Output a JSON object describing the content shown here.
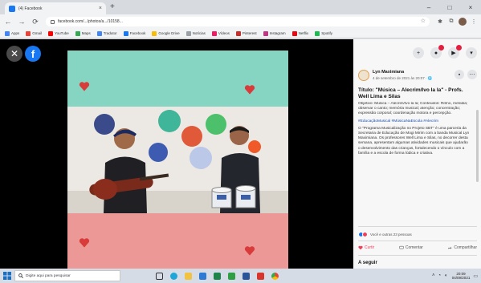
{
  "browser": {
    "tab_title": "(4) Facebook",
    "tab_close": "×",
    "new_tab": "+",
    "address": "facebook.com/.../photos/a.../10158...",
    "window_controls": [
      "–",
      "□",
      "×"
    ],
    "nav": {
      "back": "←",
      "forward": "→",
      "reload": "⟳"
    }
  },
  "bookmarks": [
    {
      "label": "Apps",
      "color": "#4285f4"
    },
    {
      "label": "Gmail",
      "color": "#ea4335"
    },
    {
      "label": "YouTube",
      "color": "#ff0000"
    },
    {
      "label": "Maps",
      "color": "#34a853"
    },
    {
      "label": "Tradutor",
      "color": "#4285f4"
    },
    {
      "label": "Facebook",
      "color": "#1877f2"
    },
    {
      "label": "Google Drive",
      "color": "#fbbc04"
    },
    {
      "label": "Notícias",
      "color": "#9aa0a6"
    },
    {
      "label": "Vídeos",
      "color": "#e91e63"
    },
    {
      "label": "Pinterest",
      "color": "#c4302b"
    },
    {
      "label": "Instagram",
      "color": "#c13584"
    },
    {
      "label": "Netflix",
      "color": "#e50914"
    },
    {
      "label": "Spotify",
      "color": "#1db954"
    }
  ],
  "post": {
    "author": "Lyn Maximiana",
    "date": "4 de setembro de 2021 às 20:07 · 🌐",
    "title": "Título: \"Música – Alecrim/Ivo la la\" - Profs. Well Lima e Silas",
    "paragraphs": [
      "Objetivo: Música – Alecrim/Ivo la la; Conteúdos: Ritmo, melodia; observar o canto; memória musical; atenção; concentração; expressão corporal; coordenação motora e percepção.",
      "#EducaçãoMusical #MúsicaNaEscola #Alecrim",
      "O \"Programa Musicalização no Projeto SBT\" é uma parceria da Secretaria de Educação de Mogi Mirim com a banda Musical Lyn Maximiana. Os professores Well Lima e Silas, no decorrer desta semana, apresentam algumas atividades musicais que ajudarão o desenvolvimento das crianças, fortalecendo o vínculo com a família e a escola de forma lúdica e criativa."
    ],
    "reactions_text": "Você e outras 23 pessoas",
    "like": "Curtir",
    "comment": "Comentar",
    "share": "Compartilhar",
    "section": "A seguir"
  },
  "taskbar": {
    "search_placeholder": "Digite aqui para pesquisar",
    "time": "20:09",
    "date": "04/09/2021"
  },
  "colors": {
    "band_top": "#86d5c2",
    "band_bottom": "#ec9896",
    "heart": "#d93a3a",
    "facebook": "#1877f2"
  }
}
